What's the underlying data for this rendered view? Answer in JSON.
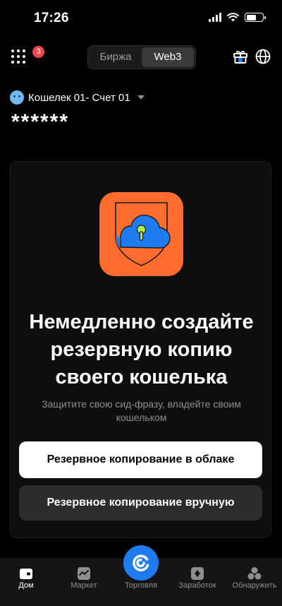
{
  "status_bar": {
    "time": "17:26"
  },
  "header": {
    "apps_badge": "3",
    "tabs": [
      {
        "label": "Биржа",
        "active": false
      },
      {
        "label": "Web3",
        "active": true
      }
    ]
  },
  "account": {
    "name": "Кошелек 01- Счет 01",
    "balance_masked": "******"
  },
  "card": {
    "title_lines": [
      "Немедленно создайте",
      "резервную копию",
      "своего кошелька"
    ],
    "subtitle": "Защитите свою сид-фразу, владейте своим кошельком",
    "cloud_button": "Резервное копирование в облаке",
    "manual_button": "Резервное копирование вручную"
  },
  "bottom_nav": {
    "items": [
      {
        "label": "Дом",
        "icon": "wallet-icon",
        "active": true
      },
      {
        "label": "Маркет",
        "icon": "market-chart-icon",
        "active": false
      },
      {
        "label": "Торговля",
        "icon": "trade-icon",
        "active": false
      },
      {
        "label": "Заработок",
        "icon": "earn-icon",
        "active": false
      },
      {
        "label": "Обнаружить",
        "icon": "discover-icon",
        "active": false
      }
    ]
  },
  "colors": {
    "accent_blue": "#1e7bf2",
    "illustration_orange": "#ff6d2e",
    "badge_red": "#f0474f"
  }
}
